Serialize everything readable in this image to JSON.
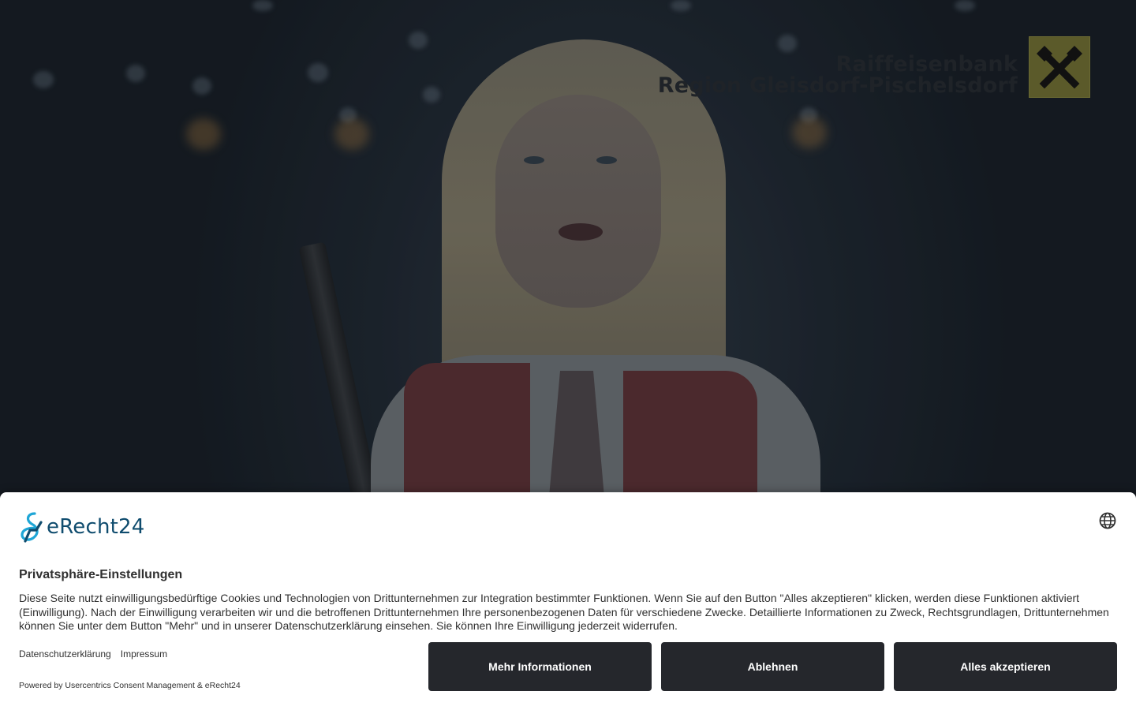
{
  "bank": {
    "line1": "Raiffeisenbank",
    "line2": "Region Gleisdorf-Pischelsdorf",
    "mark_icon": "raiffeisen-crossed-horses-logo",
    "mark_color": "#5b5a2a"
  },
  "consent": {
    "brand_name": "eRecht24",
    "brand_color": "#0f4c6e",
    "language_icon": "globe-icon",
    "title": "Privatsphäre-Einstellungen",
    "description": "Diese Seite nutzt einwilligungsbedürftige Cookies und Technologien von Drittunternehmen zur Integration bestimmter Funktionen. Wenn Sie auf den Button \"Alles akzeptieren\" klicken, werden diese Funktionen aktiviert (Einwilligung). Nach der Einwilligung verarbeiten wir und die betroffenen Drittunternehmen Ihre personenbezogenen Daten für verschiedene Zwecke. Detaillierte Informationen zu Zweck, Rechtsgrundlagen, Drittunternehmen können Sie unter dem Button \"Mehr\" und in unserer Datenschutzerklärung einsehen. Sie können Ihre Einwilligung jederzeit widerrufen.",
    "links": {
      "privacy": "Datenschutzerklärung",
      "imprint": "Impressum"
    },
    "powered_by": "Powered by Usercentrics Consent Management & eRecht24",
    "buttons": {
      "more_info": "Mehr Informationen",
      "deny": "Ablehnen",
      "accept_all": "Alles akzeptieren"
    },
    "button_color": "#25272c"
  }
}
